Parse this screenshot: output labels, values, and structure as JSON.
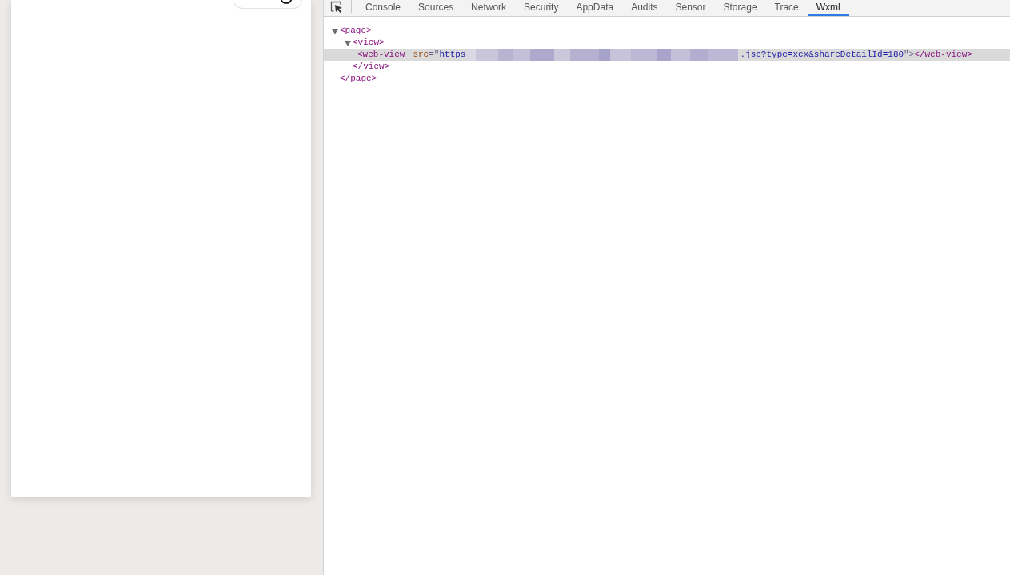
{
  "devtools_tabs": [
    {
      "label": "Console",
      "selected": false
    },
    {
      "label": "Sources",
      "selected": false
    },
    {
      "label": "Network",
      "selected": false
    },
    {
      "label": "Security",
      "selected": false
    },
    {
      "label": "AppData",
      "selected": false
    },
    {
      "label": "Audits",
      "selected": false
    },
    {
      "label": "Sensor",
      "selected": false
    },
    {
      "label": "Storage",
      "selected": false
    },
    {
      "label": "Trace",
      "selected": false
    },
    {
      "label": "Wxml",
      "selected": true
    }
  ],
  "wxml_tree": [
    {
      "selected": false,
      "expanded": true,
      "line": [
        {
          "kind": "tag",
          "text": "<page>"
        }
      ],
      "closing": [
        {
          "kind": "tag",
          "text": "</page>"
        }
      ],
      "children": [
        {
          "selected": false,
          "expanded": true,
          "line": [
            {
              "kind": "tag",
              "text": "<view>"
            }
          ],
          "closing": [
            {
              "kind": "tag",
              "text": "</view>"
            }
          ],
          "children": [
            {
              "selected": true,
              "line": [
                {
                  "kind": "tag",
                  "text": "<web-view"
                },
                {
                  "kind": "attr-name",
                  "text": "src"
                },
                {
                  "kind": "punct",
                  "text": "=\""
                },
                {
                  "kind": "attr-value",
                  "text": "https"
                },
                {
                  "kind": "redacted"
                },
                {
                  "kind": "attr-value",
                  "text": ".jsp?type=xcx&shareDetailId=180"
                },
                {
                  "kind": "punct",
                  "text": "\">"
                },
                {
                  "kind": "tag",
                  "text": "</web-view>"
                }
              ]
            }
          ]
        }
      ]
    }
  ]
}
